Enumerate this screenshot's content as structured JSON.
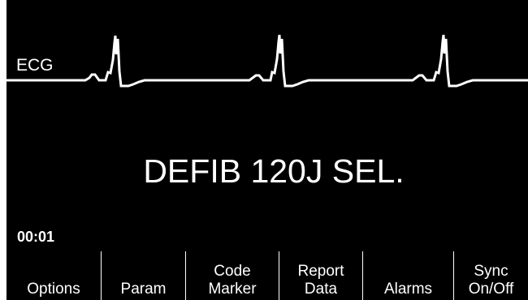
{
  "trace": {
    "label": "ECG",
    "color": "#ffffff"
  },
  "message": "DEFIB 120J SEL.",
  "timer": "00:01",
  "softkeys": [
    {
      "label": "Options"
    },
    {
      "label": "Param"
    },
    {
      "label": "Code\nMarker"
    },
    {
      "label": "Report\nData"
    },
    {
      "label": "Alarms"
    },
    {
      "label": "Sync\nOn/Off"
    }
  ],
  "colors": {
    "background": "#000000",
    "foreground": "#ffffff"
  }
}
